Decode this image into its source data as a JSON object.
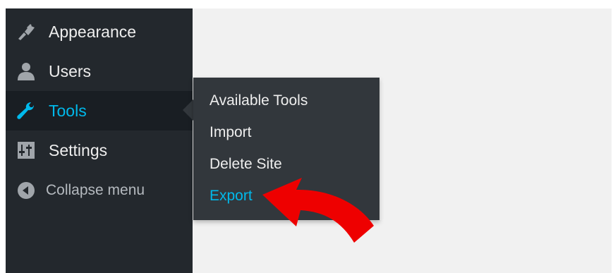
{
  "sidebar": {
    "items": [
      {
        "label": "Appearance",
        "icon": "paintbrush-icon"
      },
      {
        "label": "Users",
        "icon": "user-icon"
      },
      {
        "label": "Tools",
        "icon": "wrench-icon",
        "active": true
      },
      {
        "label": "Settings",
        "icon": "sliders-icon"
      }
    ],
    "collapse_label": "Collapse menu",
    "collapse_icon": "collapse-arrow-icon"
  },
  "flyout": {
    "items": [
      {
        "label": "Available Tools"
      },
      {
        "label": "Import"
      },
      {
        "label": "Delete Site"
      },
      {
        "label": "Export",
        "highlighted": true
      }
    ]
  },
  "colors": {
    "sidebar_bg": "#23282d",
    "active_bg": "#191e23",
    "flyout_bg": "#32373c",
    "accent": "#00b9eb",
    "annotation_arrow": "#ee0000"
  }
}
